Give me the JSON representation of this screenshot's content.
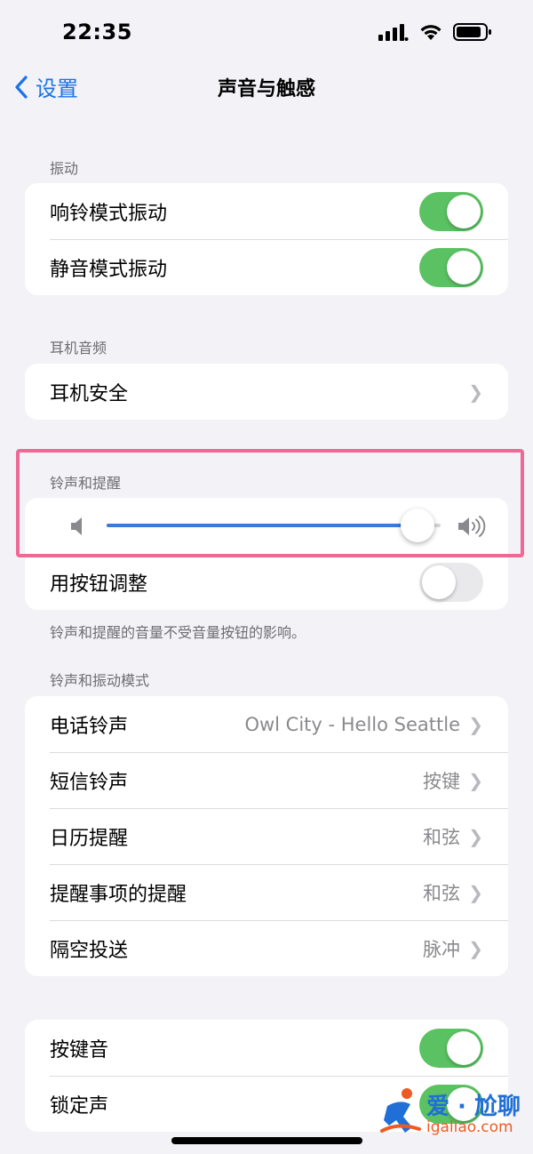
{
  "status": {
    "time": "22:35"
  },
  "nav": {
    "back_label": "设置",
    "title": "声音与触感"
  },
  "vibration": {
    "label": "振动",
    "rows": [
      {
        "label": "响铃模式振动",
        "on": true
      },
      {
        "label": "静音模式振动",
        "on": true
      }
    ]
  },
  "headphone": {
    "label": "耳机音频",
    "rows": [
      {
        "label": "耳机安全"
      }
    ]
  },
  "ringer": {
    "label": "铃声和提醒",
    "volume_level": 0.93,
    "adjust_label": "用按钮调整",
    "adjust_on": false,
    "note": "铃声和提醒的音量不受音量按钮的影响。"
  },
  "patterns": {
    "label": "铃声和振动模式",
    "rows": [
      {
        "label": "电话铃声",
        "value": "Owl City - Hello Seattle"
      },
      {
        "label": "短信铃声",
        "value": "按键"
      },
      {
        "label": "日历提醒",
        "value": "和弦"
      },
      {
        "label": "提醒事项的提醒",
        "value": "和弦"
      },
      {
        "label": "隔空投送",
        "value": "脉冲"
      }
    ]
  },
  "sounds": {
    "rows": [
      {
        "label": "按键音",
        "on": true
      },
      {
        "label": "锁定声",
        "on": true
      }
    ]
  },
  "watermark": {
    "title": "爱 · 尬聊",
    "url": "igaliao.com"
  },
  "colors": {
    "accent": "#1a73e8",
    "toggle_on": "#5ac262",
    "slider_fill": "#3a7bd5",
    "highlight": "#ec6a94"
  }
}
